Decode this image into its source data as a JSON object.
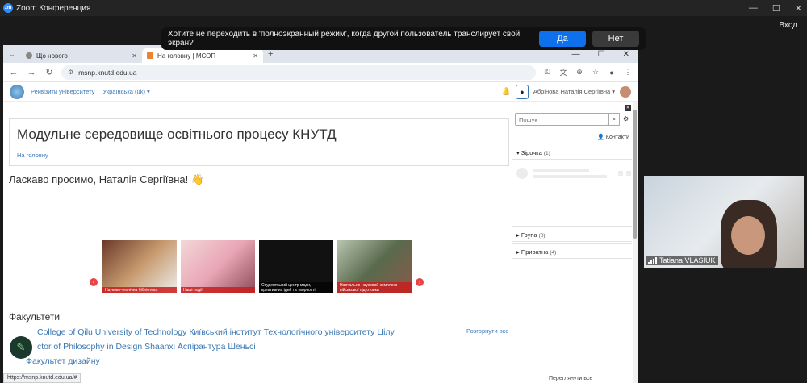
{
  "zoom": {
    "title": "Zoom Конференция",
    "exit_label": "Вход",
    "window_controls": [
      "—",
      "☐",
      "✕"
    ]
  },
  "share_prompt": {
    "text": "Хотите не переходить в 'полноэкранный режим', когда другой пользователь транслирует свой экран?",
    "yes_label": "Да",
    "no_label": "Нет",
    "yes_color": "#0e71eb"
  },
  "browser": {
    "tabs": [
      {
        "label": "Що нового",
        "close": "✕"
      },
      {
        "label": "На головну | МСОП",
        "close": "✕"
      }
    ],
    "new_tab": "+",
    "window_controls": [
      "—",
      "☐",
      "✕"
    ],
    "url": "msnp.knutd.edu.ua",
    "status_url": "https://msnp.knutd.edu.ua/#"
  },
  "moodle": {
    "nav_links": [
      "Реквізити університету",
      "Українська (uk) ▾"
    ],
    "user_name": "Абрінова Наталія Сергіївна ▾",
    "page_title": "Модульне середовище освітнього процесу КНУТД",
    "breadcrumb": "На головну",
    "welcome": "Ласкаво просимо, Наталія Сергіївна! 👋",
    "slides": [
      {
        "caption": "Науково-технічна бібліотека"
      },
      {
        "caption": "Наші події"
      },
      {
        "caption": "Студентський центр моди, креативних ідей та творчості"
      },
      {
        "caption": "Навчально-науковий комплекс військової підготовки"
      }
    ],
    "faculties_heading": "Факультети",
    "expand_all": "Розгорнути все",
    "courses": [
      "College of Qilu University of Technology Київський інститут Технологічного університету Цілу",
      "ctor of Philosophy in Design Shaanxi Аспірантура Шеньсі",
      "Факультет дизайну"
    ]
  },
  "drawer": {
    "search_placeholder": "Пошук",
    "contacts_label": "Контакти",
    "sections": [
      {
        "label": "▾ Зірочка",
        "count": "(1)"
      },
      {
        "label": "▸ Група",
        "count": "(0)"
      },
      {
        "label": "▸ Приватна",
        "count": "(4)"
      }
    ],
    "view_all": "Переглянути все"
  },
  "participant": {
    "name": "Tatiana VLASIUK"
  }
}
